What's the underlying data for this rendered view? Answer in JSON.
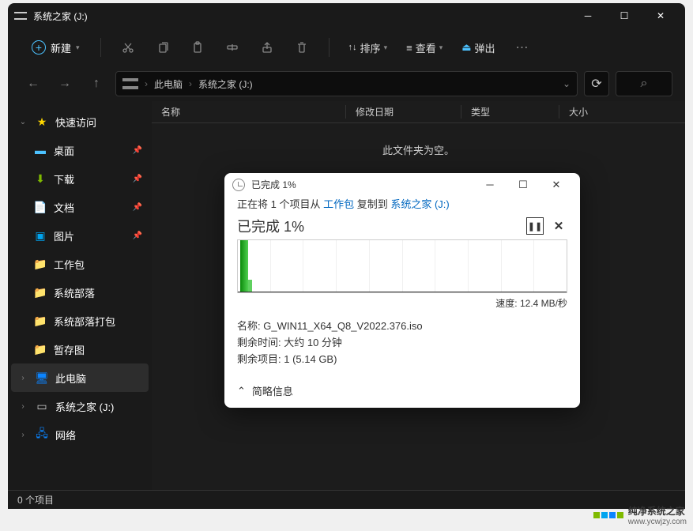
{
  "window": {
    "title": "系统之家 (J:)"
  },
  "toolbar": {
    "new_label": "新建",
    "sort_label": "排序",
    "view_label": "查看",
    "eject_label": "弹出"
  },
  "breadcrumb": {
    "root": "此电脑",
    "current": "系统之家 (J:)"
  },
  "sidebar": {
    "quick_access": "快速访问",
    "desktop": "桌面",
    "downloads": "下载",
    "documents": "文档",
    "pictures": "图片",
    "work": "工作包",
    "sysdeploy": "系统部落",
    "sysdeploy_pack": "系统部落打包",
    "temp_img": "暂存图",
    "this_pc": "此电脑",
    "drive": "系统之家 (J:)",
    "network": "网络"
  },
  "headers": {
    "name": "名称",
    "modified": "修改日期",
    "type": "类型",
    "size": "大小"
  },
  "content": {
    "empty": "此文件夹为空。"
  },
  "statusbar": {
    "count": "0 个项目"
  },
  "dialog": {
    "title": "已完成 1%",
    "copy_prefix": "正在将 1 个项目从 ",
    "copy_src": "工作包",
    "copy_mid": " 复制到 ",
    "copy_dst": "系统之家 (J:)",
    "done": "已完成 1%",
    "speed_label": "速度: ",
    "speed_value": "12.4 MB/秒",
    "name_label": "名称: ",
    "name_value": "G_WIN11_X64_Q8_V2022.376.iso",
    "time_label": "剩余时间: ",
    "time_value": "大约 10 分钟",
    "items_label": "剩余项目: ",
    "items_value": "1 (5.14 GB)",
    "expand": "简略信息"
  },
  "watermark": {
    "brand": "纯净系统之家",
    "url": "www.ycwjzy.com"
  }
}
